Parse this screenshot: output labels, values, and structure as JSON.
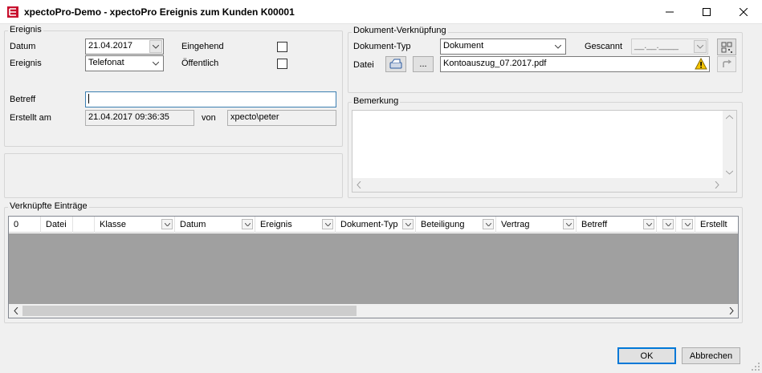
{
  "window": {
    "title": "xpectoPro-Demo - xpectoPro Ereignis zum Kunden K00001",
    "icon": "app-logo-icon"
  },
  "ereignis": {
    "group_label": "Ereignis",
    "datum_label": "Datum",
    "datum_value": "21.04.2017",
    "ereignis_label": "Ereignis",
    "ereignis_value": "Telefonat",
    "eingehend_label": "Eingehend",
    "eingehend_checked": false,
    "oeffentlich_label": "Öffentlich",
    "oeffentlich_checked": false,
    "betreff_label": "Betreff",
    "betreff_value": "",
    "erstellt_label": "Erstellt am",
    "erstellt_value": "21.04.2017 09:36:35",
    "von_label": "von",
    "von_value": "xpecto\\peter"
  },
  "dokument": {
    "group_label": "Dokument-Verknüpfung",
    "typ_label": "Dokument-Typ",
    "typ_value": "Dokument",
    "gescannt_label": "Gescannt",
    "gescannt_value": "__.__.____",
    "datei_label": "Datei",
    "browse_label": "...",
    "datei_value": "Kontoauszug_07.2017.pdf"
  },
  "bemerkung": {
    "group_label": "Bemerkung"
  },
  "verknuepfte": {
    "group_label": "Verknüpfte Einträge",
    "count": "0",
    "columns": [
      "Datei",
      "",
      "Klasse",
      "Datum",
      "Ereignis",
      "Dokument-Typ",
      "Beteiligung",
      "Vertrag",
      "Betreff",
      "",
      "",
      "Erstellt"
    ]
  },
  "footer": {
    "ok_label": "OK",
    "cancel_label": "Abbrechen"
  },
  "colors": {
    "accent": "#0078d7",
    "grid_body": "#a0a0a0",
    "warning": "#f5c400"
  }
}
